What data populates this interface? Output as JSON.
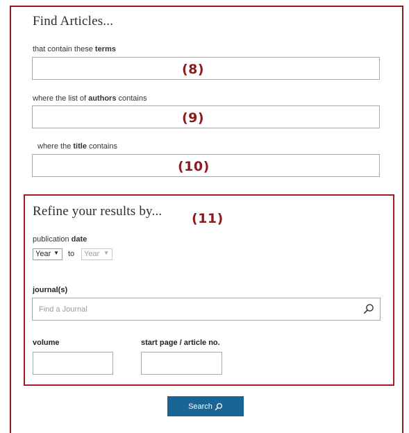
{
  "find": {
    "heading": "Find Articles...",
    "terms_prefix": "that contain these ",
    "terms_bold": "terms",
    "authors_prefix": "where the list of ",
    "authors_bold": "authors",
    "authors_suffix": " contains",
    "title_prefix": "where the ",
    "title_bold": "title",
    "title_suffix": " contains",
    "terms_value": "",
    "authors_value": "",
    "title_value": ""
  },
  "annotations": [
    "(8)",
    "(9)",
    "(10)",
    "(11)"
  ],
  "refine": {
    "heading": "Refine your results by...",
    "date_prefix": "publication ",
    "date_bold": "date",
    "year_from": "Year",
    "to_label": "to",
    "year_to": "Year",
    "journal_label": "journal(s)",
    "journal_placeholder": "Find a Journal",
    "volume_label": "volume",
    "start_page_label": "start page / article no.",
    "volume_value": "",
    "start_page_value": ""
  },
  "search_button": {
    "label": "Search"
  },
  "colors": {
    "frame": "#8b1a1a",
    "annotation": "#8b1a1a",
    "button": "#1a6595"
  },
  "icons": [
    "search-icon",
    "caret-down-icon"
  ]
}
